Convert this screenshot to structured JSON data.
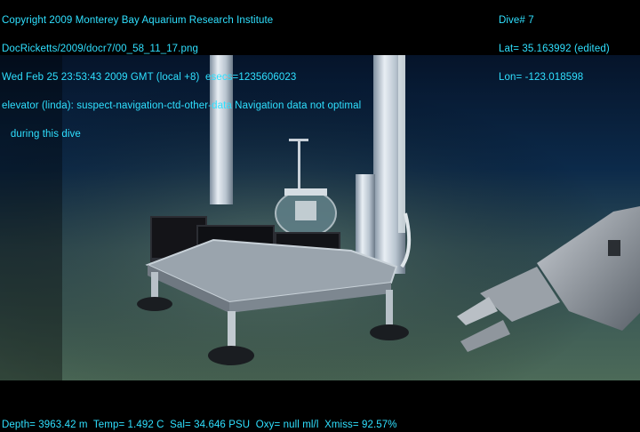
{
  "overlay": {
    "copyright": "Copyright 2009 Monterey Bay Aquarium Research Institute",
    "file_path": "DocRicketts/2009/docr7/00_58_11_17.png",
    "timestamp": "Wed Feb 25 23:53:43 2009 GMT (local +8)  esecs=1235606023",
    "annotation_line1": "elevator (linda): suspect-navigation-ctd-other-data Navigation data not optimal",
    "annotation_line2": "   during this dive",
    "dive": "Dive# 7",
    "latitude": "Lat= 35.163992 (edited)",
    "longitude": "Lon= -123.018598",
    "sensors": "Depth= 3963.42 m  Temp= 1.492 C  Sal= 34.646 PSU  Oxy= null ml/l  Xmiss= 92.57%"
  },
  "colors": {
    "overlay_text": "#2fe0ff",
    "water": "#0c2a4a",
    "seafloor": "#4a6a5a"
  }
}
